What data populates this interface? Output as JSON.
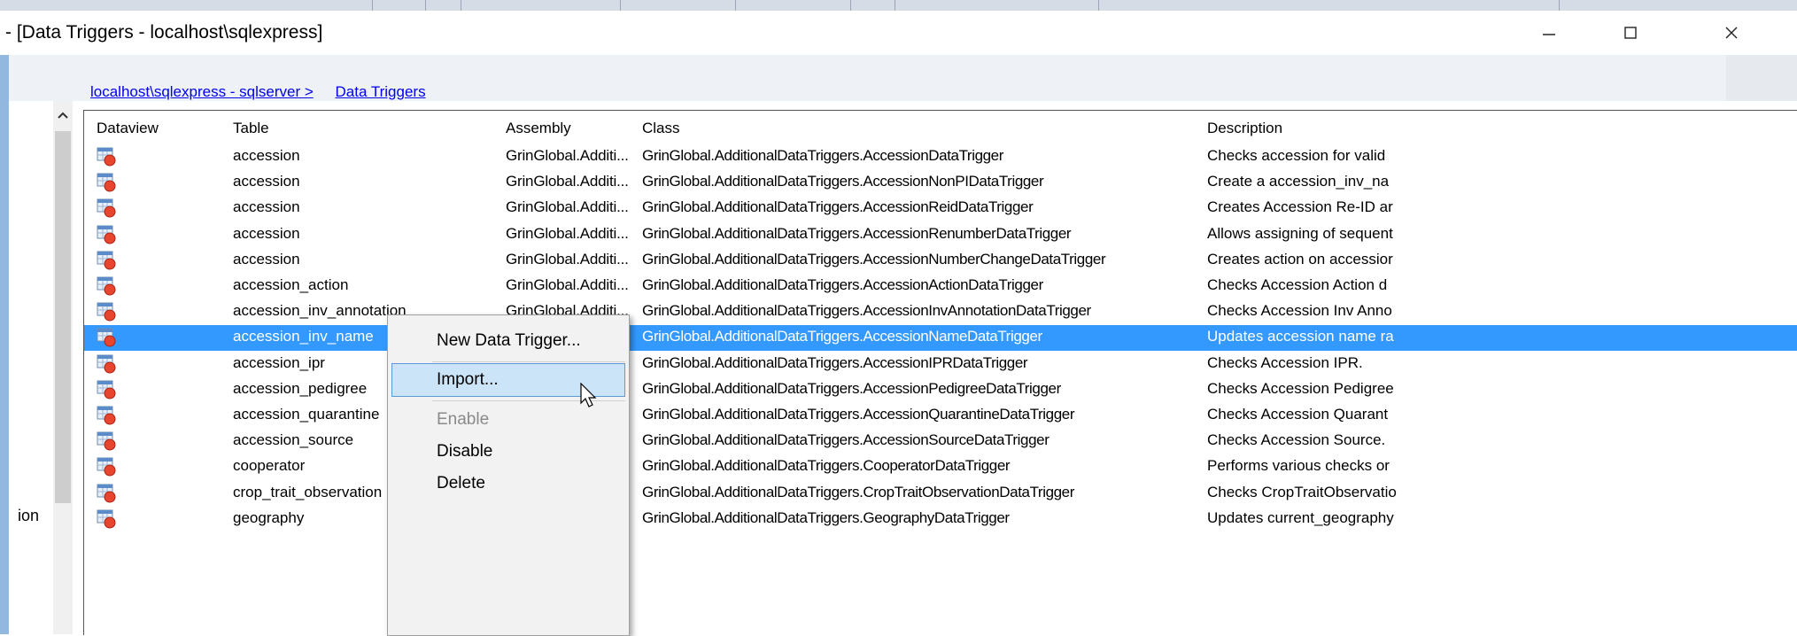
{
  "window": {
    "title": "- [Data Triggers - localhost\\sqlexpress]",
    "minimize_icon": "minimize-icon",
    "maximize_icon": "maximize-icon",
    "close_icon": "close-icon"
  },
  "left_panel": {
    "partial_label": "ion",
    "scroll_up_icon": "chevron-up-icon"
  },
  "breadcrumb": {
    "server_link": "localhost\\sqlexpress - sqlserver >",
    "current_link": "Data Triggers"
  },
  "grid": {
    "columns": [
      "Dataview",
      "Table",
      "Assembly",
      "Class",
      "Description"
    ],
    "dataview_icon": "dataview-icon",
    "selected_row_index": 7,
    "rows": [
      {
        "table": "accession",
        "assembly": "GrinGlobal.Additi...",
        "class": "GrinGlobal.AdditionalDataTriggers.AccessionDataTrigger",
        "description": "Checks accession for valid"
      },
      {
        "table": "accession",
        "assembly": "GrinGlobal.Additi...",
        "class": "GrinGlobal.AdditionalDataTriggers.AccessionNonPIDataTrigger",
        "description": "Create a accession_inv_na"
      },
      {
        "table": "accession",
        "assembly": "GrinGlobal.Additi...",
        "class": "GrinGlobal.AdditionalDataTriggers.AccessionReidDataTrigger",
        "description": "Creates Accession Re-ID ar"
      },
      {
        "table": "accession",
        "assembly": "GrinGlobal.Additi...",
        "class": "GrinGlobal.AdditionalDataTriggers.AccessionRenumberDataTrigger",
        "description": "Allows assigning of sequent"
      },
      {
        "table": "accession",
        "assembly": "GrinGlobal.Additi...",
        "class": "GrinGlobal.AdditionalDataTriggers.AccessionNumberChangeDataTrigger",
        "description": "Creates action on accessior"
      },
      {
        "table": "accession_action",
        "assembly": "GrinGlobal.Additi...",
        "class": "GrinGlobal.AdditionalDataTriggers.AccessionActionDataTrigger",
        "description": "Checks Accession Action d"
      },
      {
        "table": "accession_inv_annotation",
        "assembly": "GrinGlobal.Additi...",
        "class": "GrinGlobal.AdditionalDataTriggers.AccessionInvAnnotationDataTrigger",
        "description": "Checks Accession Inv Anno"
      },
      {
        "table": "accession_inv_name",
        "assembly": "GrinGlobal.Additi...",
        "class": "GrinGlobal.AdditionalDataTriggers.AccessionNameDataTrigger",
        "description": "Updates accession name ra"
      },
      {
        "table": "accession_ipr",
        "assembly": "",
        "class": "GrinGlobal.AdditionalDataTriggers.AccessionIPRDataTrigger",
        "description": "Checks Accession IPR."
      },
      {
        "table": "accession_pedigree",
        "assembly": "",
        "class": "GrinGlobal.AdditionalDataTriggers.AccessionPedigreeDataTrigger",
        "description": "Checks Accession Pedigree"
      },
      {
        "table": "accession_quarantine",
        "assembly": "",
        "class": "GrinGlobal.AdditionalDataTriggers.AccessionQuarantineDataTrigger",
        "description": "Checks Accession Quarant"
      },
      {
        "table": "accession_source",
        "assembly": "",
        "class": "GrinGlobal.AdditionalDataTriggers.AccessionSourceDataTrigger",
        "description": "Checks Accession Source."
      },
      {
        "table": "cooperator",
        "assembly": "",
        "class": "GrinGlobal.AdditionalDataTriggers.CooperatorDataTrigger",
        "description": "Performs various checks or"
      },
      {
        "table": "crop_trait_observation",
        "assembly": "",
        "class": "GrinGlobal.AdditionalDataTriggers.CropTraitObservationDataTrigger",
        "description": "Checks CropTraitObservatio"
      },
      {
        "table": "geography",
        "assembly": "",
        "class": "GrinGlobal.AdditionalDataTriggers.GeographyDataTrigger",
        "description": "Updates current_geography"
      }
    ]
  },
  "context_menu": {
    "items": [
      {
        "label": "New Data Trigger...",
        "enabled": true
      },
      {
        "label": "Import...",
        "enabled": true,
        "highlighted": true
      },
      {
        "label": "Enable",
        "enabled": false
      },
      {
        "label": "Disable",
        "enabled": true
      },
      {
        "label": "Delete",
        "enabled": true
      }
    ],
    "cursor_icon": "mouse-pointer-icon"
  },
  "colors": {
    "selection": "#3399ff",
    "menu_highlight": "#cce4f7",
    "link": "#0000ee",
    "left_accent": "#93b8e0"
  }
}
